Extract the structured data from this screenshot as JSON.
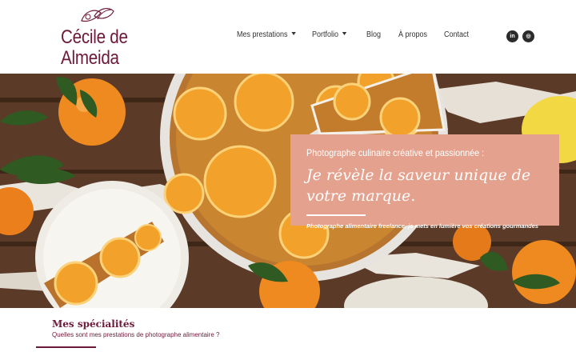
{
  "brand": {
    "line1": "Cécile de",
    "line2": "Almeida",
    "logo_icon": "citrus-leaf-icon",
    "color": "#6d1a3a"
  },
  "nav": {
    "items": [
      {
        "label": "Mes prestations",
        "has_dropdown": true
      },
      {
        "label": "Portfolio",
        "has_dropdown": true
      },
      {
        "label": "Blog",
        "has_dropdown": false
      },
      {
        "label": "À propos",
        "has_dropdown": false
      },
      {
        "label": "Contact",
        "has_dropdown": false
      }
    ],
    "social": [
      {
        "icon": "linkedin-icon",
        "glyph": "in"
      },
      {
        "icon": "instagram-icon",
        "glyph": "◎"
      }
    ]
  },
  "hero": {
    "kicker": "Photographe culinaire créative et passionnée :",
    "title": "Je révèle la saveur unique de votre marque.",
    "subtitle": "Photographe alimentaire freelance, je mets en lumière vos créations gourmandes",
    "box_color": "#e4a28e"
  },
  "section": {
    "title": "Mes spécialités",
    "subtitle": "Quelles sont mes prestations de photographe alimentaire ?"
  }
}
